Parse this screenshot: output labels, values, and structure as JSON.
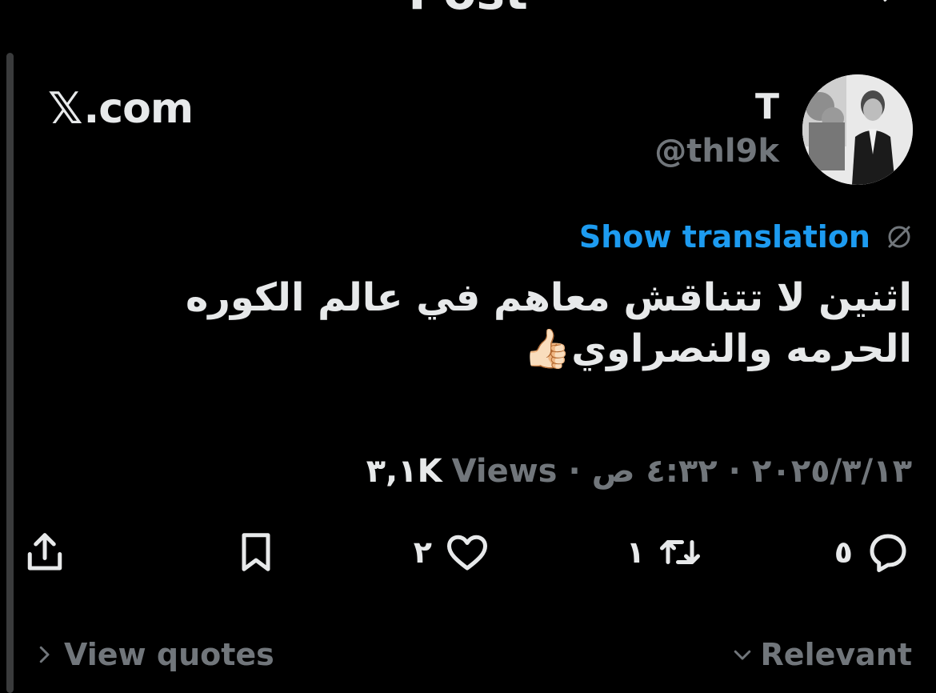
{
  "header": {
    "title": "Post"
  },
  "brand": {
    "mark": "𝕏",
    "domain": ".com"
  },
  "author": {
    "name": "T",
    "handle": "@thl9k"
  },
  "translation": {
    "label": "Show translation"
  },
  "post": {
    "text": "اثنين لا تتناقش معاهم في عالم الكوره الحرمه والنصراوي👍🏻"
  },
  "meta": {
    "date": "٢٠٢٥/٣/١٣",
    "separator1": "·",
    "time": "٤:٣٢ ص",
    "separator2": "·",
    "views_count": "٣,١K",
    "views_label": "Views"
  },
  "actions": {
    "replies": "٥",
    "reposts": "١",
    "likes": "٢"
  },
  "footer": {
    "view_quotes": "View quotes",
    "sort": "Relevant"
  },
  "icons": {
    "reply": "reply-icon",
    "repost": "repost-icon",
    "like": "heart-icon",
    "bookmark": "bookmark-icon",
    "share": "share-icon",
    "translate": "translate-icon"
  },
  "colors": {
    "background": "#000000",
    "text": "#e7e9ea",
    "muted": "#71767b",
    "link": "#1d9bf0"
  }
}
